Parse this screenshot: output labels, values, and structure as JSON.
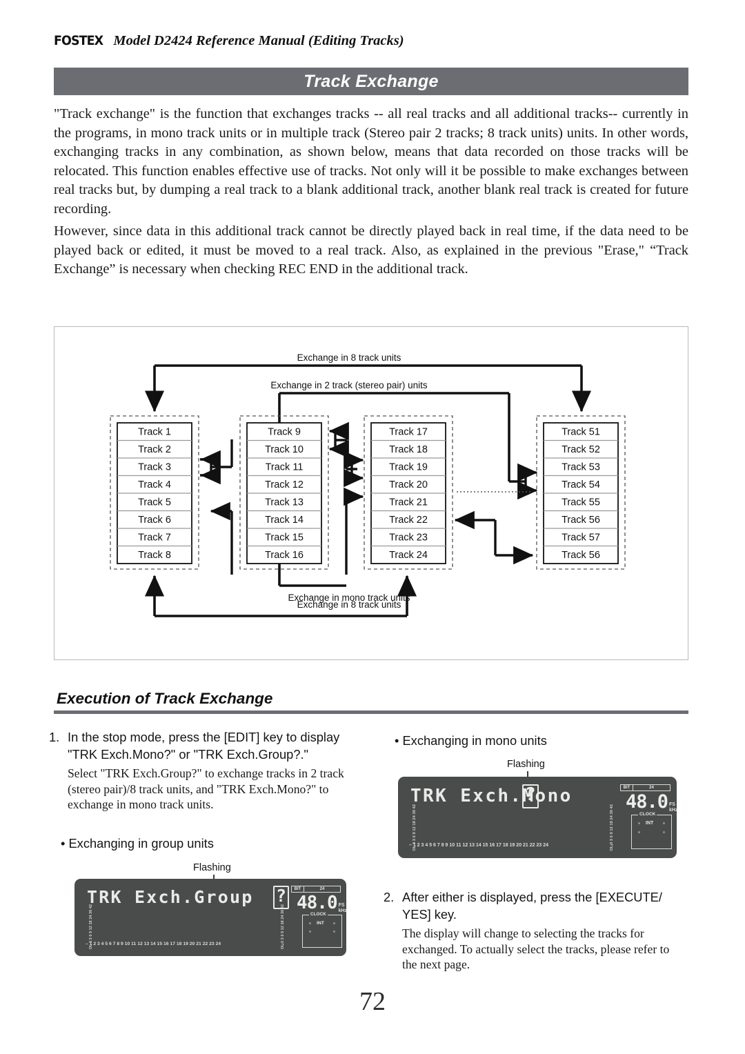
{
  "header": {
    "brand": "FOSTEX",
    "title": "Model D2424  Reference Manual (Editing Tracks)",
    "banner": "Track Exchange"
  },
  "body": {
    "paragraph1": "\"Track exchange\" is the function that exchanges tracks -- all real tracks and all additional tracks-- currently in the programs, in mono track units or in multiple track (Stereo pair 2 tracks; 8 track units) units.\nIn other words, exchanging tracks in any combination, as shown below, means that data recorded on those tracks will be relocated. This function enables effective use of tracks.  Not only will it be possible to make exchanges between real tracks but, by dumping a real track to a blank additional track, another blank real track is created for future recording.",
    "paragraph2": "However, since data in this additional track cannot be directly played back in real time, if the data need to be played back or edited, it must be moved to a real track.\nAlso, as explained in the previous \"Erase,\" “Track Exchange” is necessary when checking REC END in the additional track."
  },
  "figure": {
    "labels": {
      "top8": "Exchange in 8 track units",
      "stereo": "Exchange in 2 track (stereo pair) units",
      "mono": "Exchange in mono track units",
      "bottom8": "Exchange in 8 track units"
    },
    "columns": [
      {
        "tracks": [
          "Track 1",
          "Track 2",
          "Track 3",
          "Track 4",
          "Track 5",
          "Track 6",
          "Track 7",
          "Track 8"
        ]
      },
      {
        "tracks": [
          "Track 9",
          "Track 10",
          "Track 11",
          "Track 12",
          "Track 13",
          "Track 14",
          "Track 15",
          "Track 16"
        ]
      },
      {
        "tracks": [
          "Track 17",
          "Track 18",
          "Track 19",
          "Track 20",
          "Track 21",
          "Track 22",
          "Track 23",
          "Track 24"
        ]
      },
      {
        "tracks": [
          "Track 51",
          "Track 52",
          "Track 53",
          "Track 54",
          "Track 55",
          "Track 56",
          "Track 57",
          "Track 56"
        ]
      }
    ]
  },
  "section": {
    "heading": "Execution of Track Exchange"
  },
  "steps": [
    {
      "num": "1.",
      "lead": "In the stop mode, press the [EDIT] key to display \"TRK Exch.Mono?\" or \"TRK Exch.Group?.\"",
      "body": "Select \"TRK Exch.Group?\" to exchange tracks in 2 track (stereo pair)/8 track units, and \"TRK Exch.Mono?\" to exchange in mono track units."
    },
    {
      "num": "2.",
      "lead": "After either is displayed, press the [EXECUTE/ YES] key.",
      "body": "The display will change to selecting the tracks for exchanged.\nTo actually select the tracks, please refer to the next page."
    }
  ],
  "bullets": {
    "group": "• Exchanging in group units",
    "mono": "• Exchanging in mono units"
  },
  "lcd_group": {
    "flashing_label": "Flashing",
    "display_text": "TRK Exch.Group",
    "flashing_char": "?",
    "bit_label": "BIT",
    "bit_value": "24",
    "fs_number": "48.0",
    "fs_unit_top": "FS",
    "fs_unit_bottom": "kHz",
    "clock_label": "CLOCK",
    "clock_value": "INT",
    "meter_scale": "OL 0 3 6 9 12 18 24 30 42",
    "meter_numbers": "–  1  2  3  4  5  6  7  8  9 10 11 12 13 14 15 16 17 18 19 20 21 22 23 24",
    "meter_numbers_right": "–"
  },
  "lcd_mono": {
    "flashing_label": "Flashing",
    "display_text": "TRK Exch.Mono",
    "flashing_char": "?",
    "bit_label": "BIT",
    "bit_value": "24",
    "fs_number": "48.0",
    "fs_unit_top": "FS",
    "fs_unit_bottom": "kHz",
    "clock_label": "CLOCK",
    "clock_value": "INT",
    "meter_scale": "OL 0 3 6 9 12 18 24 30 42",
    "meter_numbers": "–  1  2  3  4  5  6  7  8  9 10 11 12 13 14 15 16 17 18 19 20 21 22 23 24",
    "meter_numbers_right": "–"
  },
  "footer": {
    "page": "72"
  },
  "colors": {
    "banner": "#6b6d72",
    "lcd": "#4a4c4c",
    "lcd_text": "#e9ebe8"
  }
}
